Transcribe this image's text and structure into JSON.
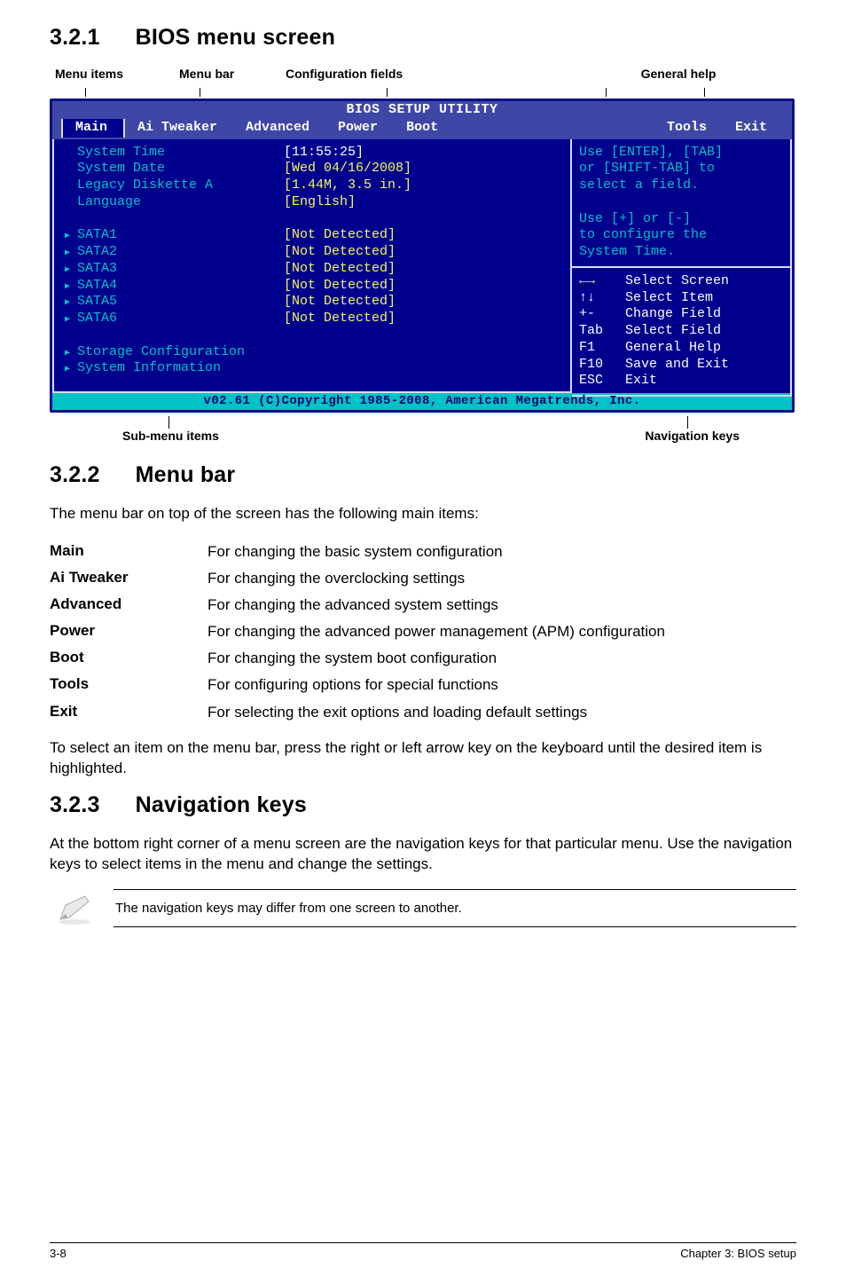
{
  "headings": {
    "s321": {
      "num": "3.2.1",
      "title": "BIOS menu screen"
    },
    "s322": {
      "num": "3.2.2",
      "title": "Menu bar"
    },
    "s323": {
      "num": "3.2.3",
      "title": "Navigation keys"
    }
  },
  "captions": {
    "top": {
      "c1": "Menu items",
      "c2": "Menu bar",
      "c3": "Configuration fields",
      "c4": "General help"
    },
    "bottom": {
      "left": "Sub-menu items",
      "right": "Navigation keys"
    }
  },
  "bios": {
    "title": "BIOS SETUP UTILITY",
    "tabs": [
      "Main",
      "Ai Tweaker",
      "Advanced",
      "Power",
      "Boot",
      "Tools",
      "Exit"
    ],
    "rows": [
      {
        "label": "System Time",
        "value": "[11:55:25]",
        "arrow": false,
        "valclass": "white"
      },
      {
        "label": "System Date",
        "value": "[Wed 04/16/2008]",
        "arrow": false,
        "valclass": "yellow"
      },
      {
        "label": "Legacy Diskette A",
        "value": "[1.44M, 3.5 in.]",
        "arrow": false,
        "valclass": "yellow"
      },
      {
        "label": "Language",
        "value": "[English]",
        "arrow": false,
        "valclass": "yellow"
      },
      {
        "label": "",
        "value": "",
        "arrow": false,
        "valclass": ""
      },
      {
        "label": "SATA1",
        "value": "[Not Detected]",
        "arrow": true,
        "valclass": "yellow"
      },
      {
        "label": "SATA2",
        "value": "[Not Detected]",
        "arrow": true,
        "valclass": "yellow"
      },
      {
        "label": "SATA3",
        "value": "[Not Detected]",
        "arrow": true,
        "valclass": "yellow"
      },
      {
        "label": "SATA4",
        "value": "[Not Detected]",
        "arrow": true,
        "valclass": "yellow"
      },
      {
        "label": "SATA5",
        "value": "[Not Detected]",
        "arrow": true,
        "valclass": "yellow"
      },
      {
        "label": "SATA6",
        "value": "[Not Detected]",
        "arrow": true,
        "valclass": "yellow"
      },
      {
        "label": "",
        "value": "",
        "arrow": false,
        "valclass": ""
      },
      {
        "label": "Storage Configuration",
        "value": "",
        "arrow": true,
        "valclass": ""
      },
      {
        "label": "System Information",
        "value": "",
        "arrow": true,
        "valclass": ""
      }
    ],
    "help": {
      "l1": "Use [ENTER], [TAB]",
      "l2": "or [SHIFT-TAB] to",
      "l3": "select a field.",
      "l4": "",
      "l5": "Use [+] or [-]",
      "l6": "to configure the",
      "l7": "System Time."
    },
    "keys": [
      {
        "k": "←→",
        "v": "Select Screen",
        "kcol": "yellow"
      },
      {
        "k": "↑↓",
        "v": "Select Item"
      },
      {
        "k": "+-",
        "v": "Change Field"
      },
      {
        "k": "Tab",
        "v": "Select Field"
      },
      {
        "k": "F1",
        "v": "General Help"
      },
      {
        "k": "F10",
        "v": "Save and Exit"
      },
      {
        "k": "ESC",
        "v": "Exit"
      }
    ],
    "footer": "v02.61 (C)Copyright 1985-2008, American Megatrends, Inc."
  },
  "s322_intro": "The menu bar on top of the screen has the following main items:",
  "deflist": [
    {
      "term": "Main",
      "def": "For changing the basic system configuration"
    },
    {
      "term": "Ai Tweaker",
      "def": "For changing the overclocking settings"
    },
    {
      "term": "Advanced",
      "def": "For changing the advanced system settings"
    },
    {
      "term": "Power",
      "def": "For changing the advanced power management (APM) configuration"
    },
    {
      "term": "Boot",
      "def": "For changing the system boot configuration"
    },
    {
      "term": "Tools",
      "def": "For configuring options for special functions"
    },
    {
      "term": "Exit",
      "def": "For selecting the exit options and loading default settings"
    }
  ],
  "s322_para": "To select an item on the menu bar, press the right or left arrow key on the keyboard until the desired item is highlighted.",
  "s323_para": "At the bottom right corner of a menu screen are the navigation keys for that particular menu. Use the navigation keys to select items in the menu and change the settings.",
  "note_text": "The navigation keys may differ from one screen to another.",
  "footer": {
    "left": "3-8",
    "right": "Chapter 3: BIOS setup"
  }
}
